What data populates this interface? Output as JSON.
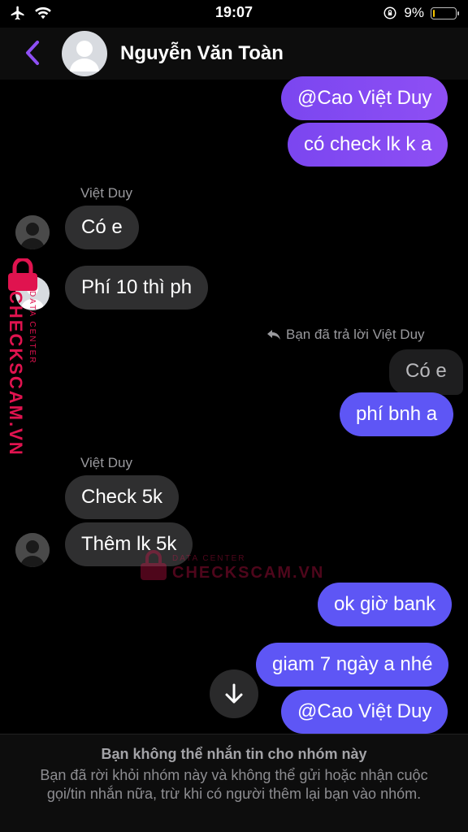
{
  "status_bar": {
    "time": "19:07",
    "battery_percent": "9%",
    "battery_level": 0.09
  },
  "header": {
    "contact_name": "Nguyễn Văn Toàn"
  },
  "messages": {
    "m1": "@Cao Việt Duy",
    "m2": "có check lk k a",
    "sender1": "Việt Duy",
    "m3": "Có e",
    "m4": "Phí 10 thì ph",
    "reply_note": "Bạn đã trả lời Việt Duy",
    "quoted": "Có e",
    "m5": "phí bnh a",
    "sender2": "Việt Duy",
    "m6": "Check 5k",
    "m7": "Thêm lk 5k",
    "m8": "ok giờ bank",
    "m9": "giam 7 ngày a nhé",
    "m10": "@Cao Việt Duy"
  },
  "watermark": {
    "main": "CHECKSCAM.VN",
    "sub": "DATA CENTER"
  },
  "footer": {
    "title": "Bạn không thể nhắn tin cho nhóm này",
    "description": "Bạn đã rời khỏi nhóm này và không thể gửi hoặc nhận cuộc gọi/tin nhắn nữa, trừ khi có người thêm lại bạn vào nhóm."
  },
  "colors": {
    "accent": "#8e4ff4",
    "mine_bubble_blue": "#5e56f5",
    "theirs_bubble": "#2f2f30",
    "watermark": "#e0134f"
  }
}
